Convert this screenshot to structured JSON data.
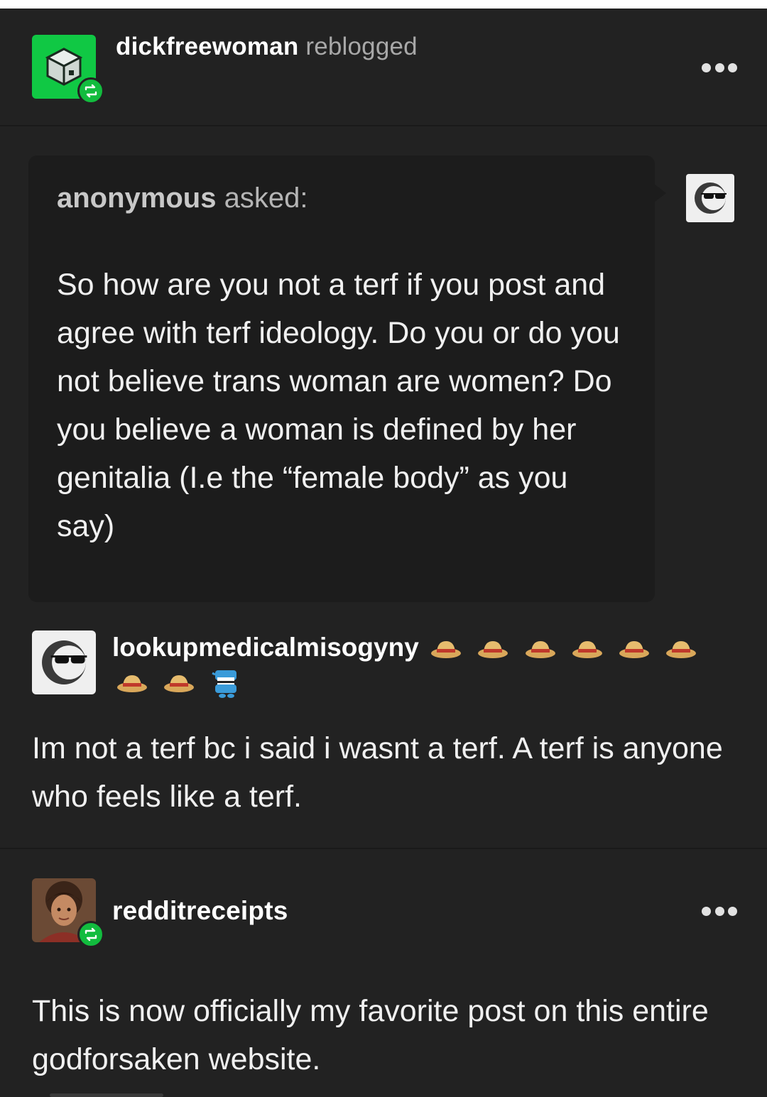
{
  "post": {
    "reblogger": "dickfreewoman",
    "reblog_action": "reblogged"
  },
  "ask": {
    "asker": "anonymous",
    "asked_label": "asked:",
    "question": "So how are you not a terf if you post and agree with terf ideology. Do you or do you not believe trans woman are women? Do you believe a woman is defined by her genitalia (I.e the “female body” as you say)"
  },
  "reply": {
    "username": "lookupmedicalmisogyny",
    "decor_icons": [
      "straw-hat-emoji",
      "straw-hat-emoji",
      "straw-hat-emoji",
      "straw-hat-emoji",
      "straw-hat-emoji",
      "straw-hat-emoji",
      "straw-hat-emoji",
      "straw-hat-emoji",
      "chattering-teeth-emoji"
    ],
    "text": "Im not a terf bc i said i wasnt a terf. A terf is anyone who feels like a terf."
  },
  "reblog2": {
    "username": "redditreceipts",
    "text": "This is now officially my favorite post on this entire godforsaken website."
  },
  "colors": {
    "background": "#222222",
    "ask_bg": "#1c1c1c",
    "reblog_green": "#12bc3e",
    "avatar_green": "#10c844"
  }
}
